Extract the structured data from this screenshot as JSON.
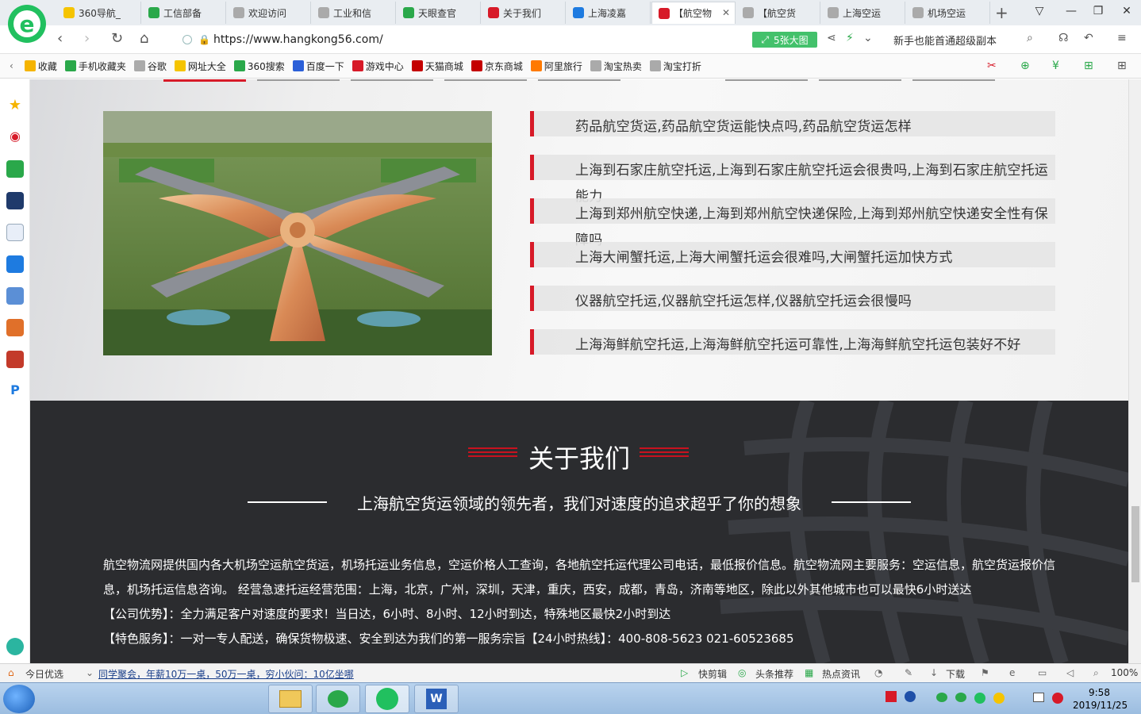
{
  "tabs": [
    {
      "label": "360导航_",
      "icon": "360-nav-icon",
      "color": "#f5c400"
    },
    {
      "label": "工信部备",
      "icon": "360-search-icon",
      "color": "#2aa84a"
    },
    {
      "label": "欢迎访问",
      "icon": "page-icon",
      "color": "#aaaaaa"
    },
    {
      "label": "工业和信",
      "icon": "page-icon",
      "color": "#aaaaaa"
    },
    {
      "label": "天眼查官",
      "icon": "360-search-icon",
      "color": "#2aa84a"
    },
    {
      "label": "关于我们",
      "icon": "airline-icon",
      "color": "#d71a28"
    },
    {
      "label": "上海凌嘉",
      "icon": "ie-icon",
      "color": "#1e7be0"
    },
    {
      "label": "【航空物",
      "icon": "airline-icon",
      "color": "#d71a28"
    },
    {
      "label": "【航空货",
      "icon": "page-icon",
      "color": "#aaaaaa"
    },
    {
      "label": "上海空运",
      "icon": "page-icon",
      "color": "#aaaaaa"
    },
    {
      "label": "机场空运",
      "icon": "page-icon",
      "color": "#aaaaaa"
    }
  ],
  "address": {
    "url": "https://www.hangkong56.com/",
    "big_image_btn": "5张大图",
    "search_hint": "新手也能首通超级副本"
  },
  "bookmarks": [
    {
      "label": "收藏",
      "icon": "star-icon",
      "color": "#f5b400"
    },
    {
      "label": "手机收藏夹",
      "icon": "phone-icon",
      "color": "#2aa84a"
    },
    {
      "label": "谷歌",
      "icon": "page-icon",
      "color": "#aaaaaa"
    },
    {
      "label": "网址大全",
      "icon": "360-nav-icon",
      "color": "#f5c400"
    },
    {
      "label": "360搜索",
      "icon": "360-search-icon",
      "color": "#2aa84a"
    },
    {
      "label": "百度一下",
      "icon": "baidu-icon",
      "color": "#2b5fd8"
    },
    {
      "label": "游戏中心",
      "icon": "game-icon",
      "color": "#d71a28"
    },
    {
      "label": "天猫商城",
      "icon": "tmall-icon",
      "color": "#c40000"
    },
    {
      "label": "京东商城",
      "icon": "jd-icon",
      "color": "#c40000"
    },
    {
      "label": "阿里旅行",
      "icon": "alitrip-icon",
      "color": "#ff7a00"
    },
    {
      "label": "淘宝热卖",
      "icon": "page-icon",
      "color": "#aaaaaa"
    },
    {
      "label": "淘宝打折",
      "icon": "page-icon",
      "color": "#aaaaaa"
    }
  ],
  "news": [
    "药品航空货运,药品航空货运能快点吗,药品航空货运怎样",
    "上海到石家庄航空托运,上海到石家庄航空托运会很贵吗,上海到石家庄航空托运能力",
    "上海到郑州航空快递,上海到郑州航空快递保险,上海到郑州航空快递安全性有保障吗",
    "上海大闸蟹托运,上海大闸蟹托运会很难吗,大闸蟹托运加快方式",
    "仪器航空托运,仪器航空托运怎样,仪器航空托运会很慢吗",
    "上海海鲜航空托运,上海海鲜航空托运可靠性,上海海鲜航空托运包装好不好"
  ],
  "about": {
    "title": "关于我们",
    "subtitle": "上海航空货运领域的领先者，我们对速度的追求超乎了你的想象",
    "para1": "航空物流网提供国内各大机场空运航空货运，机场托运业务信息，空运价格人工查询，各地航空托运代理公司电话，最低报价信息。航空物流网主要服务：空运信息，航空货运报价信息，机场托运信息咨询。 经营急速托运经营范围：上海，北京，广州，深圳，天津，重庆，西安，成都，青岛，济南等地区，除此以外其他城市也可以最快6小时送达",
    "para2": "【公司优势】：全力满足客户对速度的要求！当日达，6小时、8小时、12小时到达，特殊地区最快2小时到达",
    "para3": "【特色服务】：一对一专人配送，确保货物极速、安全到达为我们的第一服务宗旨【24小时热线】：400-808-5623  021-60523685"
  },
  "statusbar": {
    "daily": "今日优选",
    "ticker": "同学聚会，年薪10万一桌，50万一桌，穷小伙问：10亿坐哪",
    "kuaijian": "快剪辑",
    "toutiao": "头条推荐",
    "hot": "热点资讯",
    "download": "下载",
    "zoom": "100%"
  },
  "clock": {
    "time": "9:58",
    "date": "2019/11/25"
  }
}
